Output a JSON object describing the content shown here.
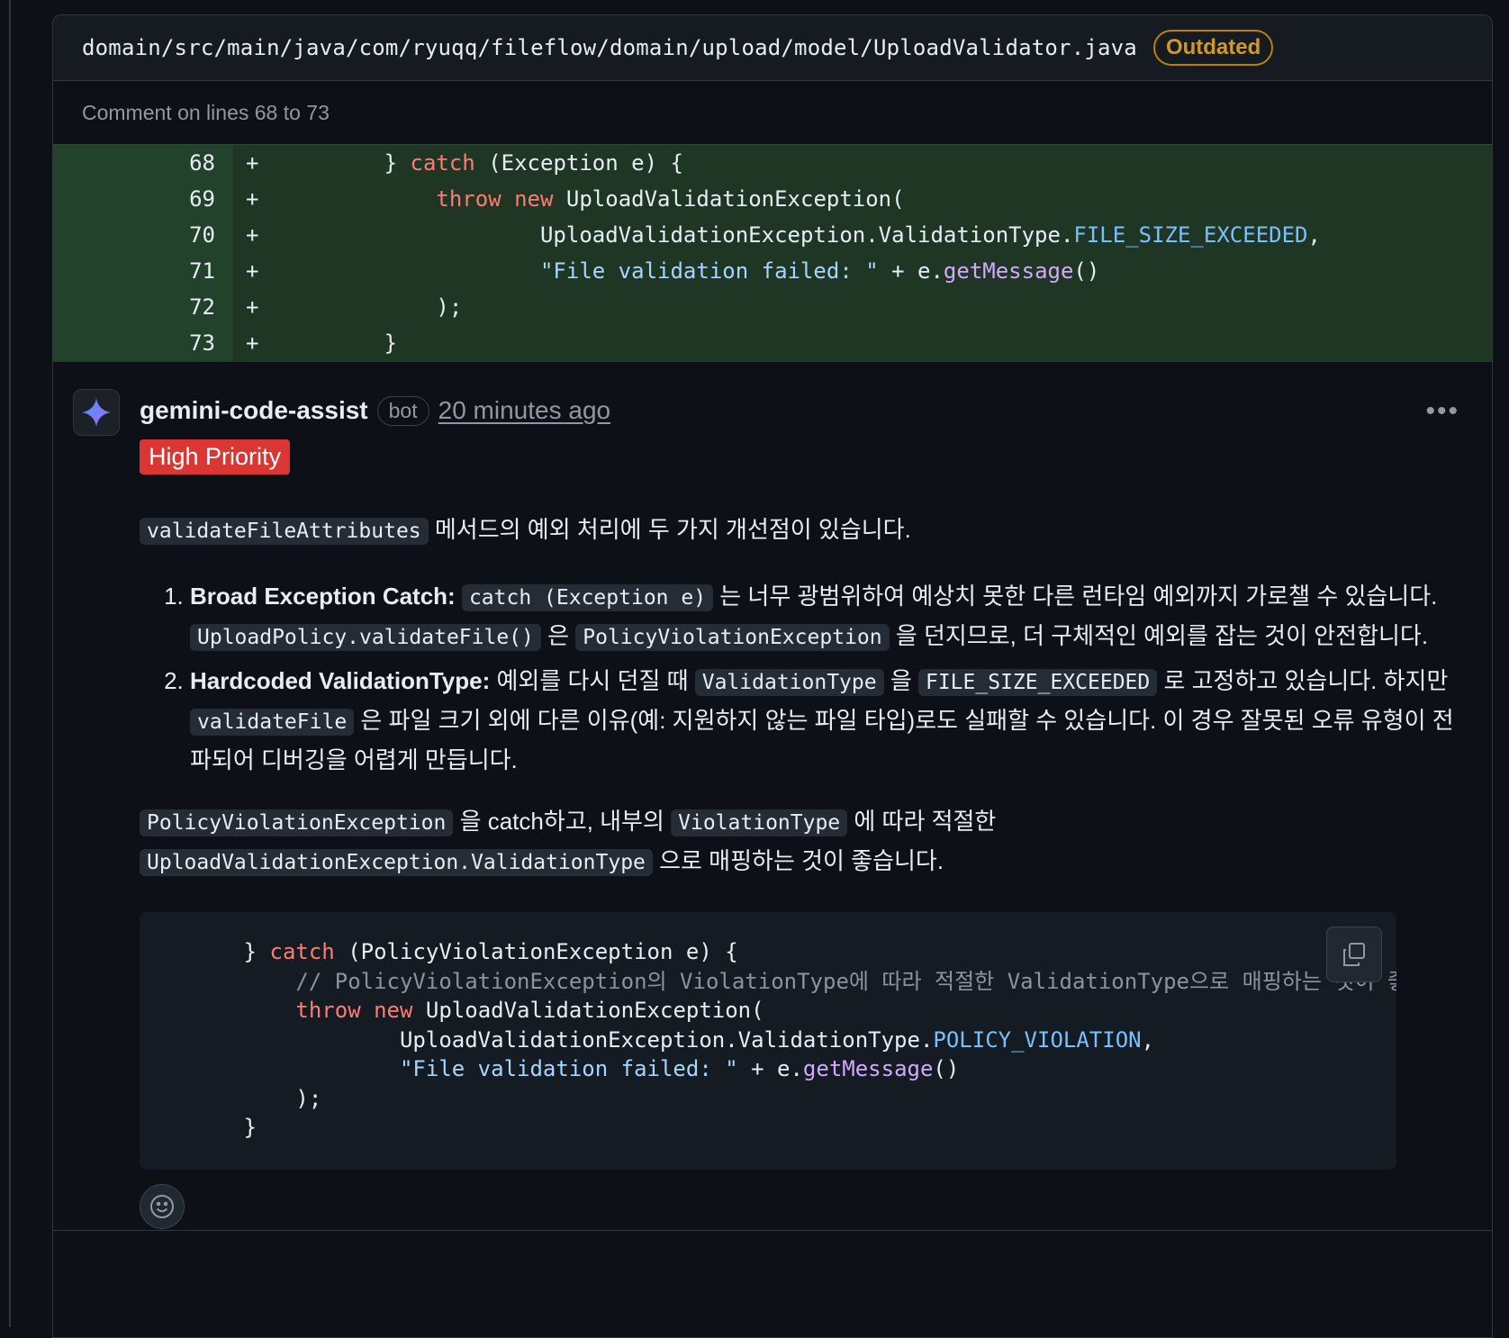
{
  "file": {
    "path": "domain/src/main/java/com/ryuqq/fileflow/domain/upload/model/UploadValidator.java",
    "status_badge": "Outdated"
  },
  "comment_on": "Comment on lines 68 to 73",
  "diff": {
    "lines": [
      {
        "num": "68",
        "sign": "+"
      },
      {
        "num": "69",
        "sign": "+"
      },
      {
        "num": "70",
        "sign": "+"
      },
      {
        "num": "71",
        "sign": "+"
      },
      {
        "num": "72",
        "sign": "+"
      },
      {
        "num": "73",
        "sign": "+"
      }
    ],
    "code": {
      "l68_indent": "        ",
      "l68_a": "} ",
      "l68_kw": "catch",
      "l68_b": " (Exception e) {",
      "l69_indent": "            ",
      "l69_kw1": "throw",
      "l69_kw2": "new",
      "l69_b": " UploadValidationException(",
      "l70_indent": "                    ",
      "l70_a": "UploadValidationException.ValidationType.",
      "l70_const": "FILE_SIZE_EXCEEDED",
      "l70_b": ",",
      "l71_indent": "                    ",
      "l71_str": "\"File validation failed: \"",
      "l71_a": " + e.",
      "l71_fn": "getMessage",
      "l71_b": "()",
      "l72_indent": "            ",
      "l72_a": ");",
      "l73_indent": "        ",
      "l73_a": "}"
    }
  },
  "comment": {
    "author": "gemini-code-assist",
    "author_badge": "bot",
    "time": "20 minutes ago",
    "more_label": "•••",
    "priority_label": "High Priority",
    "intro_code": "validateFileAttributes",
    "intro_text": " 메서드의 예외 처리에 두 가지 개선점이 있습니다.",
    "items": [
      {
        "title": "Broad Exception Catch:",
        "code1": "catch (Exception e)",
        "text1": " 는 너무 광범위하여 예상치 못한 다른 런타임 예외까지 가로챌 수 있습니다. ",
        "code2": "UploadPolicy.validateFile()",
        "text2": " 은 ",
        "code3": "PolicyViolationException",
        "text3": " 을 던지므로, 더 구체적인 예외를 잡는 것이 안전합니다."
      },
      {
        "title": "Hardcoded ValidationType:",
        "text0": " 예외를 다시 던질 때 ",
        "code1": "ValidationType",
        "text1": " 을 ",
        "code2": "FILE_SIZE_EXCEEDED",
        "text2": " 로 고정하고 있습니다. 하지만 ",
        "code3": "validateFile",
        "text3": " 은 파일 크기 외에 다른 이유(예: 지원하지 않는 파일 타입)로도 실패할 수 있습니다. 이 경우 잘못된 오류 유형이 전파되어 디버깅을 어렵게 만듭니다."
      }
    ],
    "suggest_code1": "PolicyViolationException",
    "suggest_text1": " 을 catch하고, 내부의 ",
    "suggest_code2": "ViolationType",
    "suggest_text2": " 에 따라 적절한 ",
    "suggest_code3": "UploadValidationException.ValidationType",
    "suggest_text3": " 으로 매핑하는 것이 좋습니다.",
    "codeblock": {
      "l1_indent": "        ",
      "l1_a": "} ",
      "l1_kw": "catch",
      "l1_b": " (PolicyViolationException e) {",
      "l2_indent": "            ",
      "l2_cm": "// PolicyViolationException의 ViolationType에 따라 적절한 ValidationType으로 매핑하는 것이 좋습니다",
      "l3_indent": "            ",
      "l3_kw1": "throw",
      "l3_kw2": "new",
      "l3_b": " UploadValidationException(",
      "l4_indent": "                    ",
      "l4_a": "UploadValidationException.ValidationType.",
      "l4_const": "POLICY_VIOLATION",
      "l4_b": ",",
      "l5_indent": "                    ",
      "l5_str": "\"File validation failed: \"",
      "l5_a": " + e.",
      "l5_fn": "getMessage",
      "l5_b": "()",
      "l6_indent": "            ",
      "l6_a": ");",
      "l7_indent": "        ",
      "l7_a": "}"
    }
  },
  "icons": [
    "gemini-logo-icon",
    "copy-icon",
    "smiley-icon",
    "more-options-icon"
  ],
  "colors": {
    "background": "#0d1117",
    "diff_added_bg": "#1f3625",
    "outdated_badge": "#d29922",
    "priority_badge": "#da3633",
    "keyword": "#ff7b72",
    "string": "#a5d6ff",
    "constant": "#79c0ff",
    "function": "#d2a8ff"
  }
}
